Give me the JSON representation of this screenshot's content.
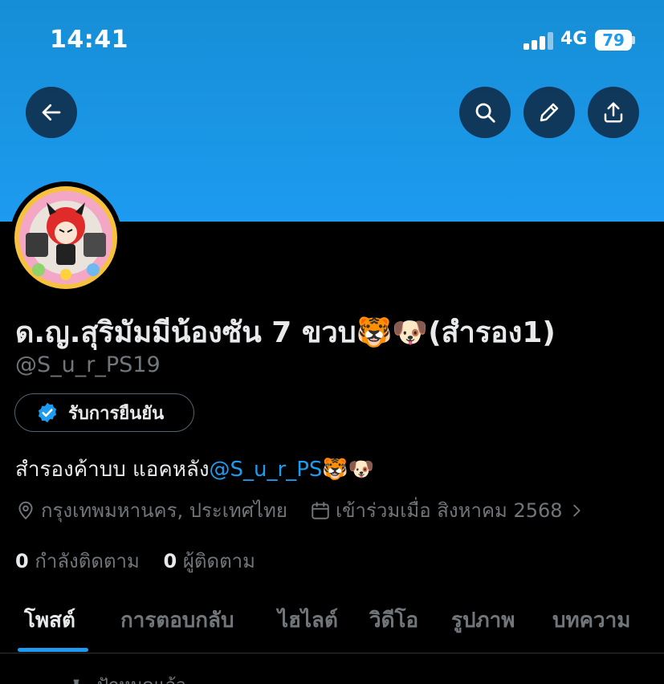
{
  "status_bar": {
    "time": "14:41",
    "network": "4G",
    "battery": "79"
  },
  "header": {
    "back_icon": "arrow-left-icon",
    "search_icon": "search-icon",
    "edit_icon": "pencil-icon",
    "share_icon": "share-icon"
  },
  "profile": {
    "display_name": "ด.ญ.สุริมัมมีน้องซัน 7 ขวบ🐯🐶(สำรอง1)",
    "handle": "@S_u_r_PS19",
    "verify_label": "รับการยืนยัน",
    "bio_text": "สำรองค้าบบ แอคหลัง",
    "bio_mention": "@S_u_r_PS",
    "bio_emoji": "🐯🐶",
    "location": "กรุงเทพมหานคร, ประเทศไทย",
    "joined": "เข้าร่วมเมื่อ สิงหาคม 2568",
    "following_count": "0",
    "following_label": "กำลังติดตาม",
    "followers_count": "0",
    "followers_label": "ผู้ติดตาม"
  },
  "tabs": [
    {
      "label": "โพสต์",
      "active": true
    },
    {
      "label": "การตอบกลับ",
      "active": false
    },
    {
      "label": "ไฮไลต์",
      "active": false
    },
    {
      "label": "วิดีโอ",
      "active": false
    },
    {
      "label": "รูปภาพ",
      "active": false
    },
    {
      "label": "บทความ",
      "active": false
    }
  ],
  "pinned_label": "ปักหมุดแล้ว",
  "colors": {
    "accent": "#1d9bf0",
    "banner": "#1d9bf0",
    "background": "#000000",
    "muted": "#71767b"
  }
}
